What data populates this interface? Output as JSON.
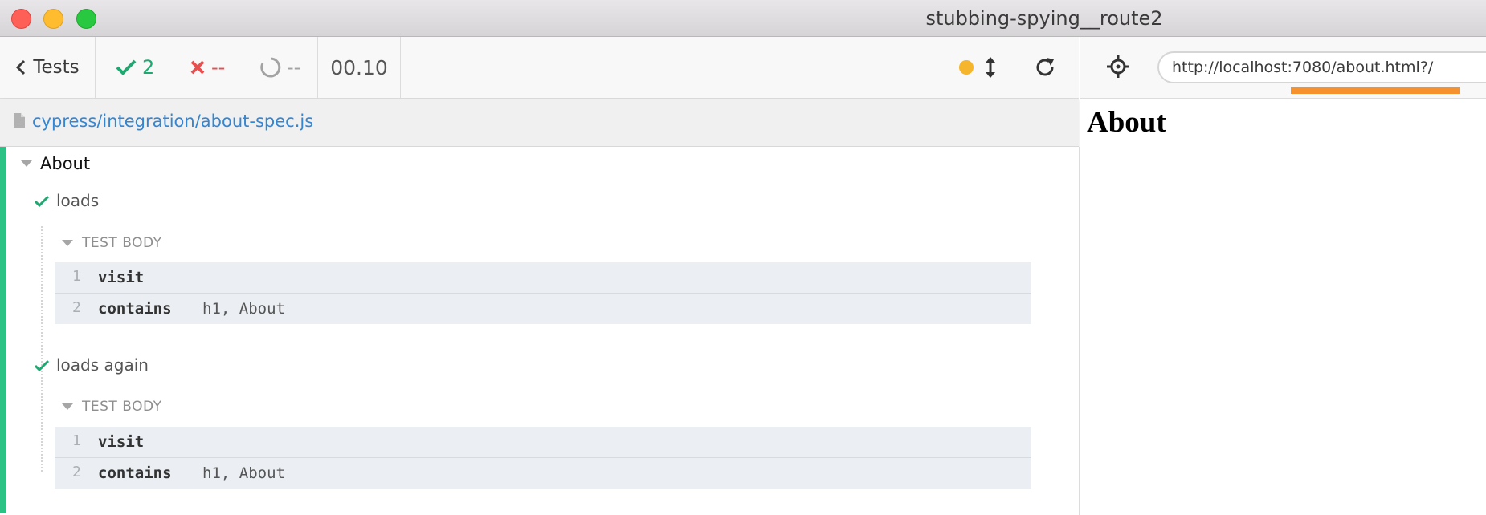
{
  "window": {
    "title": "stubbing-spying__route2"
  },
  "header": {
    "tests_label": "Tests",
    "stats": {
      "passed": "2",
      "failed": "--",
      "pending": "--"
    },
    "timer": "00.10"
  },
  "aut": {
    "url": "http://localhost:7080/about.html?/",
    "page_heading": "About"
  },
  "spec": {
    "path": "cypress/integration/about-spec.js"
  },
  "suite": {
    "title": "About",
    "tests": [
      {
        "title": "loads",
        "hook": "TEST BODY",
        "commands": [
          {
            "num": "1",
            "name": "visit",
            "message": ""
          },
          {
            "num": "2",
            "name": "contains",
            "message": "h1, About"
          }
        ]
      },
      {
        "title": "loads again",
        "hook": "TEST BODY",
        "commands": [
          {
            "num": "1",
            "name": "visit",
            "message": ""
          },
          {
            "num": "2",
            "name": "contains",
            "message": "h1, About"
          }
        ]
      }
    ]
  },
  "icons": {
    "back": "chevron-left-icon",
    "pass": "checkmark-icon",
    "fail": "x-icon",
    "pending": "circle-spinner-icon",
    "status_dot": "dot-icon",
    "resize": "arrow-updown-icon",
    "reload": "reload-icon",
    "selector": "crosshair-icon",
    "file": "file-icon"
  },
  "colors": {
    "pass": "#1fa971",
    "fail": "#e94f4f",
    "link": "#3386d4",
    "progress": "#f5922f",
    "status_dot": "#f5b52c"
  }
}
